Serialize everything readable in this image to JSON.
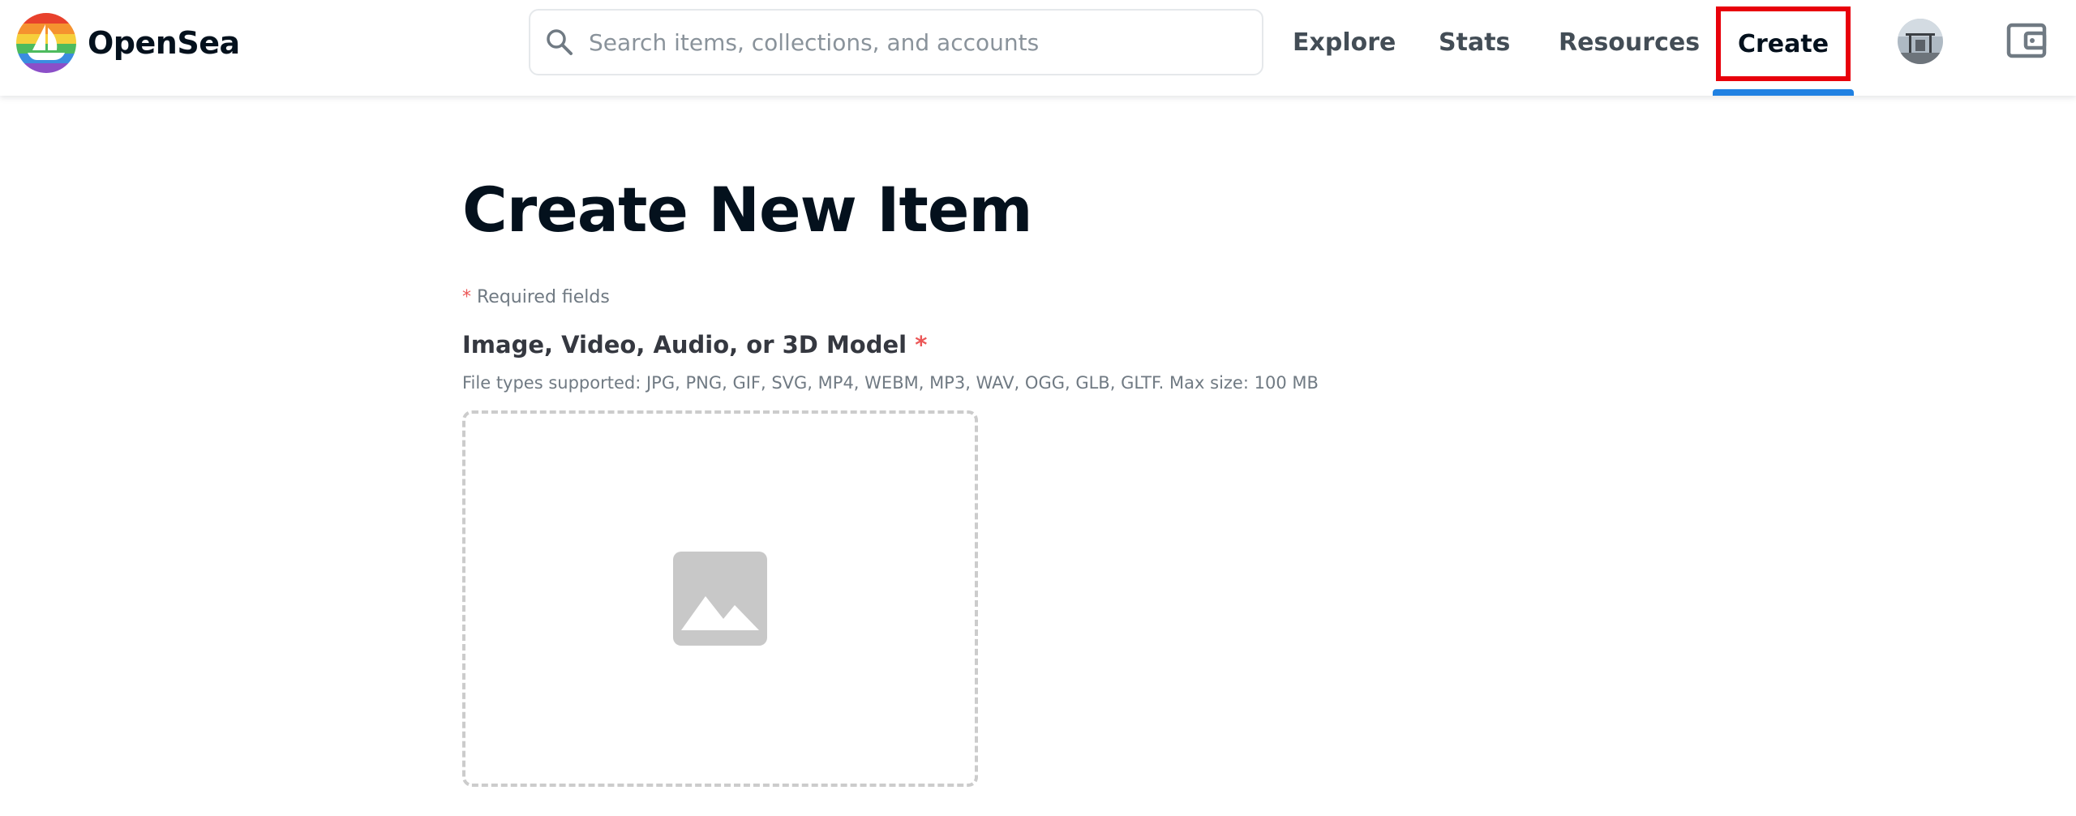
{
  "brand": {
    "name": "OpenSea",
    "logo_icon": "opensea-rainbow-logo"
  },
  "search": {
    "placeholder": "Search items, collections, and accounts",
    "value": ""
  },
  "nav": {
    "explore": "Explore",
    "stats": "Stats",
    "resources": "Resources",
    "create": "Create",
    "active": "create"
  },
  "header_icons": {
    "avatar": "profile-avatar",
    "wallet": "wallet-icon"
  },
  "page": {
    "title": "Create New Item",
    "required_asterisk": "*",
    "required_text": "Required fields",
    "media_label": "Image, Video, Audio, or 3D Model",
    "media_asterisk": "*",
    "media_help": "File types supported: JPG, PNG, GIF, SVG, MP4, WEBM, MP3, WAV, OGG, GLB, GLTF. Max size: 100 MB",
    "dropzone_icon": "image-placeholder-icon"
  },
  "colors": {
    "accent": "#2081e2",
    "highlight_box": "#e8000b",
    "required": "#eb5757",
    "dropzone_border": "#cccccc",
    "placeholder_icon": "#c8c8c8"
  }
}
